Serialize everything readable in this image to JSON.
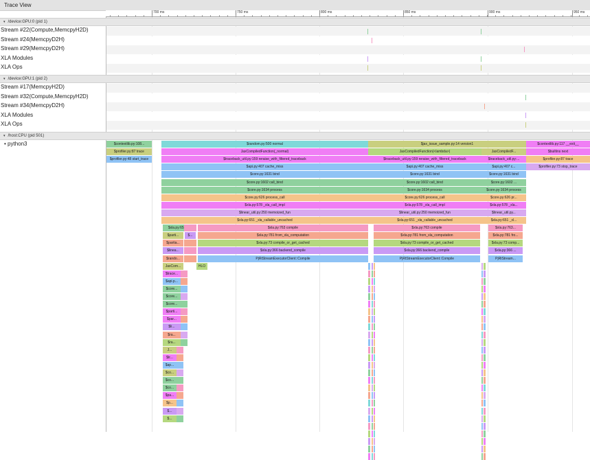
{
  "window": {
    "title": "Trace View"
  },
  "ruler": {
    "ticks": [
      "700 ms",
      "750 ms",
      "800 ms",
      "850 ms",
      "900 ms",
      "950 ms"
    ]
  },
  "processes": [
    {
      "label": "/device:GPU:0 (pid 1)",
      "tracks": [
        "Stream #22(Compute,MemcpyH2D)",
        "Stream #24(MemcpyD2H)",
        "Stream #29(MemcpyD2H)",
        "XLA Modules",
        "XLA Ops"
      ]
    },
    {
      "label": "/device:GPU:1 (pid 2)",
      "tracks": [
        "Stream #17(MemcpyH2D)",
        "Stream #32(Compute,MemcpyH2D)",
        "Stream #34(MemcpyD2H)",
        "XLA Modules",
        "XLA Ops"
      ]
    },
    {
      "label": "/host:CPU (pid 501)",
      "tracks": [
        "python3"
      ]
    }
  ],
  "colors": {
    "green": "#8fd19e",
    "cyan": "#7fd9d9",
    "khaki": "#c9cf7f",
    "magenta": "#f07ef5",
    "orange": "#f5c48a",
    "blue": "#8fc3f5",
    "pink": "#f59ac3",
    "purple": "#c99af5",
    "lilac": "#d8a9f0",
    "lime": "#b5d87f",
    "salmon": "#f5a78f"
  },
  "events": {
    "L0": [
      "$contextlib.py:108...",
      "$random.py:500 normal",
      "$jax_issue_sample.py:14 version1",
      "$contextlib.py:117 __exit__"
    ],
    "L1": [
      "$profiler.py:87 trace",
      "JaxCompiledFunction(_normal)",
      "JaxCompiledFunction(<lambda>)",
      "JaxCompiledF...",
      "$builtins next"
    ],
    "L2": [
      "$profiler.py:48 start_trace",
      "$traceback_util.py:159 reraise_with_filtered_traceback",
      "$traceback_util.py:159 reraise_with_filtered_traceback",
      "$traceback_util.py:...",
      "$profiler.py:87 trace"
    ],
    "L3": [
      "$api.py:407 cache_miss",
      "$api.py:407 cache_miss",
      "$api.py:407 c...",
      "$profiler.py:73 stop_trace"
    ],
    "L4": [
      "$core.py:1631 bind",
      "$core.py:1631 bind",
      "$core.py:1631 bind"
    ],
    "L5": [
      "$core.py:1602 call_bind",
      "$core.py:1602 call_bind",
      "$core.py:1602 ..."
    ],
    "L6": [
      "$core.py:1634 process",
      "$core.py:1634 process",
      "$core.py:1634 process"
    ],
    "L7": [
      "$core.py:626 process_call",
      "$core.py:626 process_call",
      "$core.py:626 pr..."
    ],
    "L8": [
      "$xla.py:578 _xla_call_impl",
      "$xla.py:578 _xla_call_impl",
      "$xla.py:578 _xla..."
    ],
    "L9": [
      "$linear_util.py:250 memoized_fun",
      "$linear_util.py:250 memoized_fun",
      "$linear_util.py..."
    ],
    "L10": [
      "$xla.py:651 _xla_callable_uncached",
      "$xla.py:651 _xla_callable_uncached",
      "$xla.py:651 _xl..."
    ],
    "L11": [
      "$xla.py:655 l...",
      "$xla.py:763 compile",
      "$xla.py:763 compile",
      "$xla.py:763..."
    ],
    "L12": [
      "$parti...",
      "$...",
      "$xla.py:781 from_xla_computation",
      "$xla.py:781 from_xla_computation",
      "$xla.py:781 fro..."
    ],
    "L13": [
      "$partia...",
      "$xla.py:73 compile_or_get_cached",
      "$xla.py:73 compile_or_get_cached",
      "$xla.py:73 comp..."
    ],
    "L14": [
      "$linea...",
      "$xla.py:366 backend_compile",
      "$xla.py:366 backend_compile",
      "$xla.py:366 ..."
    ],
    "L15": [
      "$rando...",
      "PjRtStreamExecutorClient::Compile",
      "PjRtStreamExecutorClient::Compile",
      "PjRtStream..."
    ],
    "L16": [
      "JaxCom...",
      "HLO"
    ],
    "deep": [
      "$trace...",
      "$api.p...",
      "$core...",
      "$core...",
      "$core...",
      "$parti...",
      "$par...",
      "$li...",
      "$ra...",
      "$ra...",
      "J...",
      "$tr...",
      "$ap...",
      "$co...",
      "$co...",
      "$co...",
      "$pa...",
      "$p...",
      "$...",
      "$..."
    ]
  }
}
